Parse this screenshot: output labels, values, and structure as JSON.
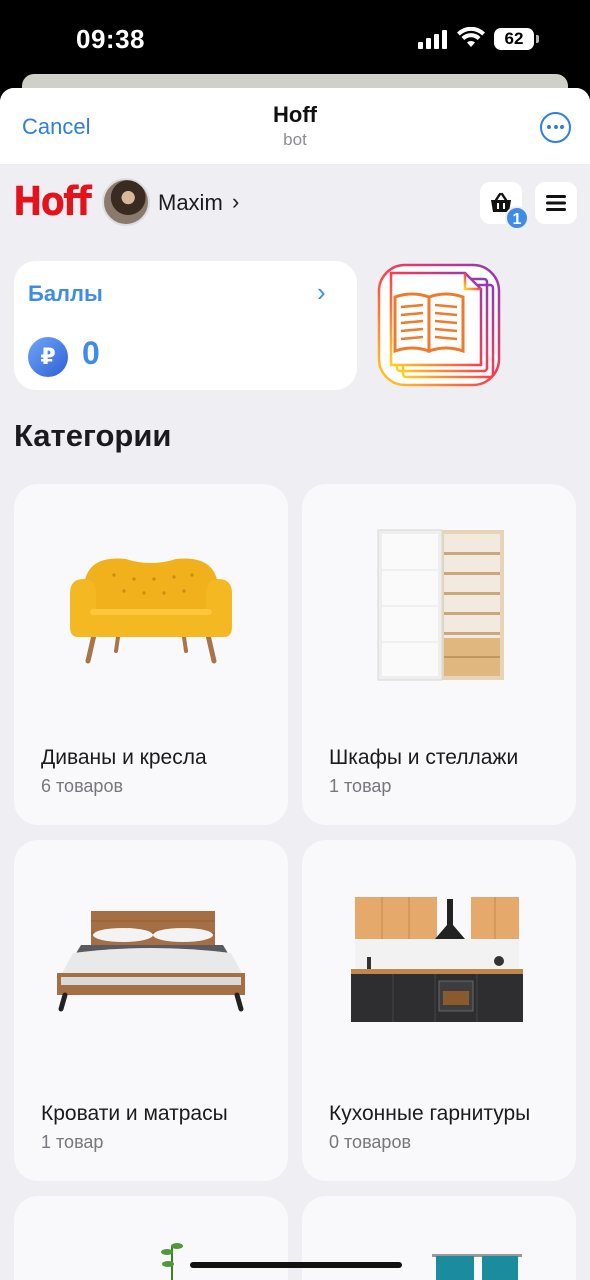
{
  "status_bar": {
    "time": "09:38",
    "battery": "62"
  },
  "nav": {
    "cancel_label": "Cancel",
    "title": "Hoff",
    "subtitle": "bot"
  },
  "header": {
    "logo": "Hoff",
    "user_name": "Maxim",
    "cart_count": "1"
  },
  "bonus": {
    "title": "Баллы",
    "currency": "₽",
    "value": "0"
  },
  "section_title": "Категории",
  "categories": [
    {
      "name": "Диваны и кресла",
      "count": "6 товаров",
      "icon": "sofa"
    },
    {
      "name": "Шкафы и стеллажи",
      "count": "1 товар",
      "icon": "wardrobe"
    },
    {
      "name": "Кровати и матрасы",
      "count": "1 товар",
      "icon": "bed"
    },
    {
      "name": "Кухонные гарнитуры",
      "count": "0 товаров",
      "icon": "kitchen"
    }
  ],
  "colors": {
    "accent": "#3f8ce8",
    "brand": "#e3121b",
    "link": "#2f7fe0"
  }
}
